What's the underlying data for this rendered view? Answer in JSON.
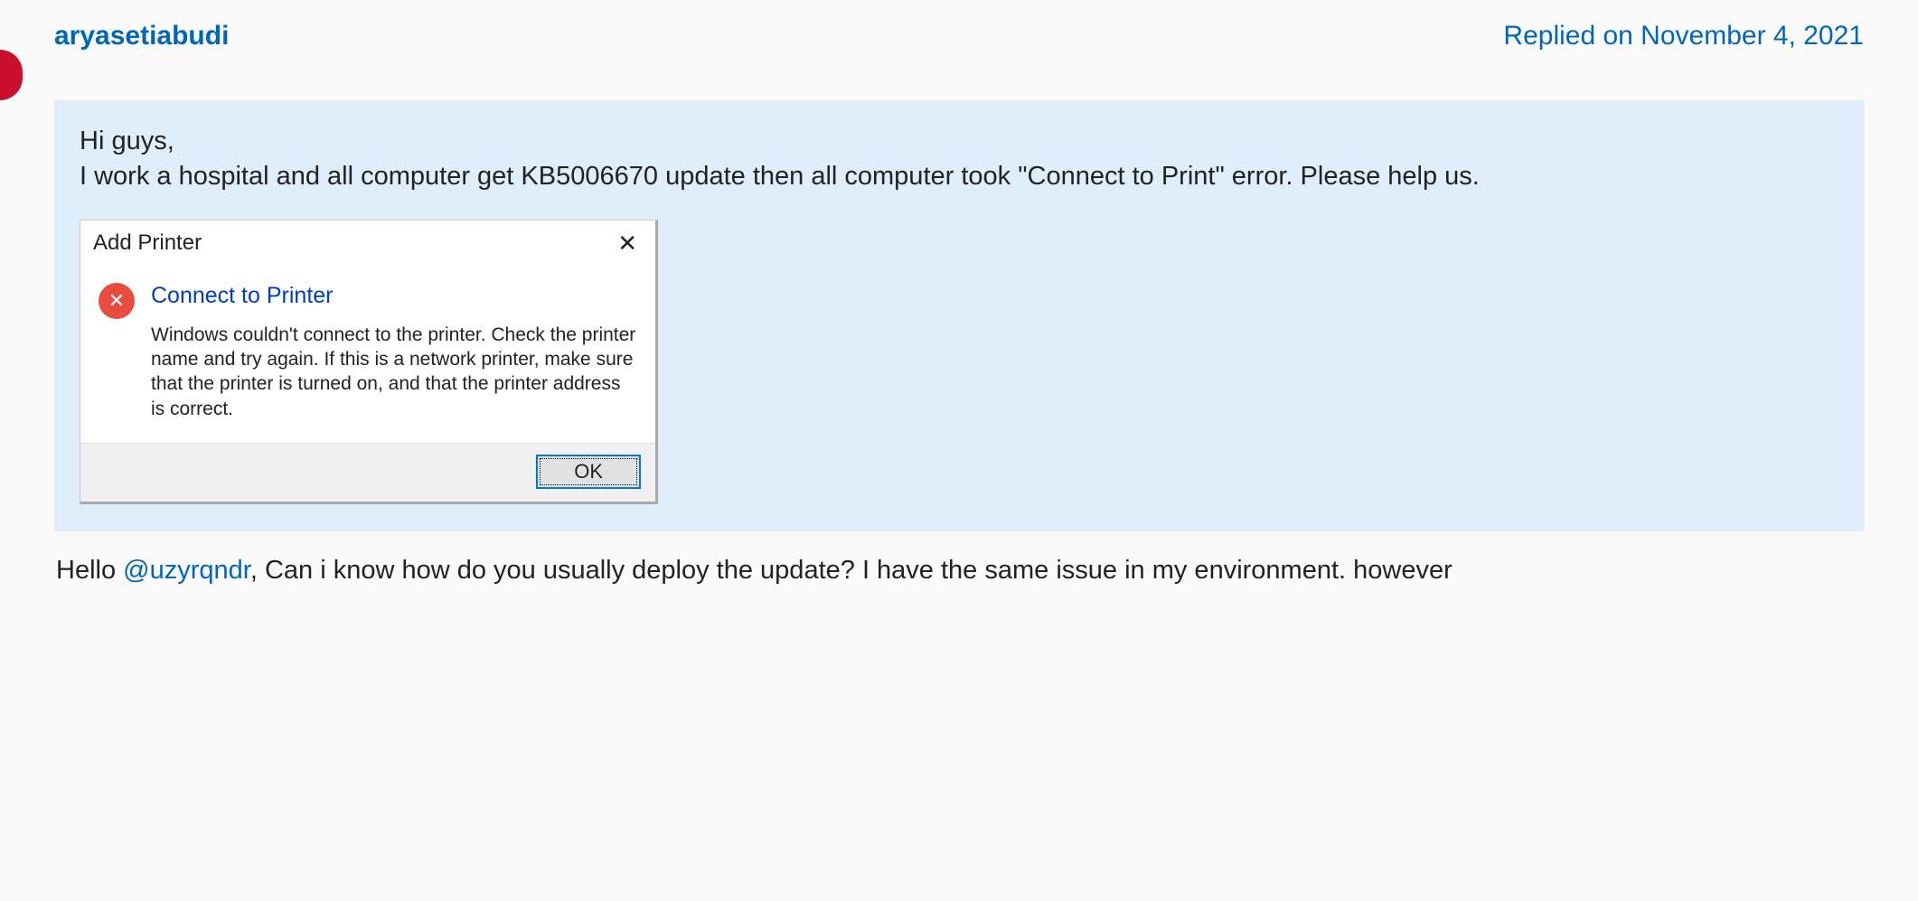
{
  "post": {
    "username": "aryasetiabudi",
    "reply_date": "Replied on November 4, 2021",
    "quote": {
      "line1": "Hi guys,",
      "line2": "I work a hospital and all computer get KB5006670 update then all computer took \"Connect to Print\" error. Please help us."
    },
    "dialog": {
      "title": "Add Printer",
      "close_glyph": "✕",
      "heading": "Connect to Printer",
      "message": "Windows couldn't connect to the printer. Check the printer name and try again. If this is a network printer, make sure that the printer is turned on, and that the printer address is correct.",
      "ok_label": "OK",
      "error_glyph": "✕"
    },
    "body": {
      "prefix": "Hello ",
      "mention": "@uzyrqndr",
      "suffix": ", Can i know how do you usually deploy the update? I have the same issue in my environment. however"
    }
  }
}
